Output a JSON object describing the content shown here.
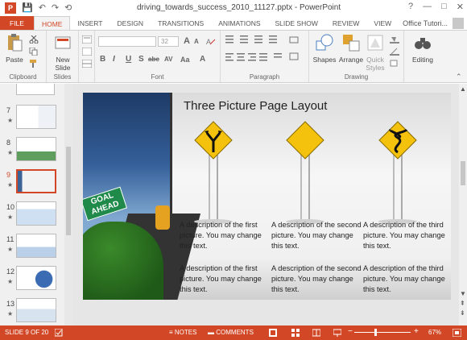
{
  "window": {
    "title": "driving_towards_success_2010_11127.pptx - PowerPoint",
    "help_icon": "?",
    "app_icon": "P",
    "minimize": "—",
    "maximize": "□",
    "close": "✕"
  },
  "qat": {
    "save": "💾",
    "undo": "↶",
    "redo": "↷",
    "start": "⟲"
  },
  "tabs": [
    "FILE",
    "HOME",
    "INSERT",
    "DESIGN",
    "TRANSITIONS",
    "ANIMATIONS",
    "SLIDE SHOW",
    "REVIEW",
    "VIEW"
  ],
  "active_tab": "HOME",
  "user": {
    "name": "Office Tutori...",
    "caret": "▾"
  },
  "ribbon": {
    "groups": [
      "Clipboard",
      "Slides",
      "Font",
      "Paragraph",
      "Drawing"
    ],
    "buttons": {
      "paste": "Paste",
      "new_slide_line1": "New",
      "new_slide_line2": "Slide",
      "shapes": "Shapes",
      "arrange": "Arrange",
      "quick_styles_line1": "Quick",
      "quick_styles_line2": "Styles",
      "editing": "Editing"
    },
    "font_size": "32",
    "font_glyphs": {
      "bold": "B",
      "italic": "I",
      "underline": "U",
      "strike": "S",
      "shadow": "abc",
      "spacing": "AV",
      "case": "Aa",
      "color": "A",
      "grow": "A",
      "shrink": "A"
    }
  },
  "thumbnails": [
    {
      "number": "7",
      "star": "★"
    },
    {
      "number": "8",
      "star": "★"
    },
    {
      "number": "9",
      "star": "★",
      "selected": true
    },
    {
      "number": "10",
      "star": "★"
    },
    {
      "number": "11",
      "star": "★"
    },
    {
      "number": "12",
      "star": "★"
    },
    {
      "number": "13",
      "star": "★"
    }
  ],
  "slide": {
    "title": "Three Picture Page Layout",
    "sign_text_line1": "GOAL",
    "sign_text_line2": "AHEAD",
    "top_texts": [
      "A description of the first picture.  You may change this text.",
      "A description of the second picture.  You may change this text.",
      "A description of the third picture.  You may change this text."
    ],
    "bottom_texts": [
      "A description of the first picture.  You may change this text.",
      "A description of the second picture.  You may change this text.",
      "A description of the third picture.  You may change this text."
    ]
  },
  "scroll": {
    "up": "▲",
    "down": "▼",
    "prev": "⇞",
    "next": "⇟"
  },
  "statusbar": {
    "slide_info": "SLIDE 9 OF 20",
    "notes": "NOTES",
    "comments": "COMMENTS",
    "zoom": "67%",
    "minus": "−",
    "plus": "+"
  },
  "colors": {
    "accent": "#D24726",
    "sign_yellow": "#F4C20D",
    "sign_green": "#1F8A4A"
  }
}
